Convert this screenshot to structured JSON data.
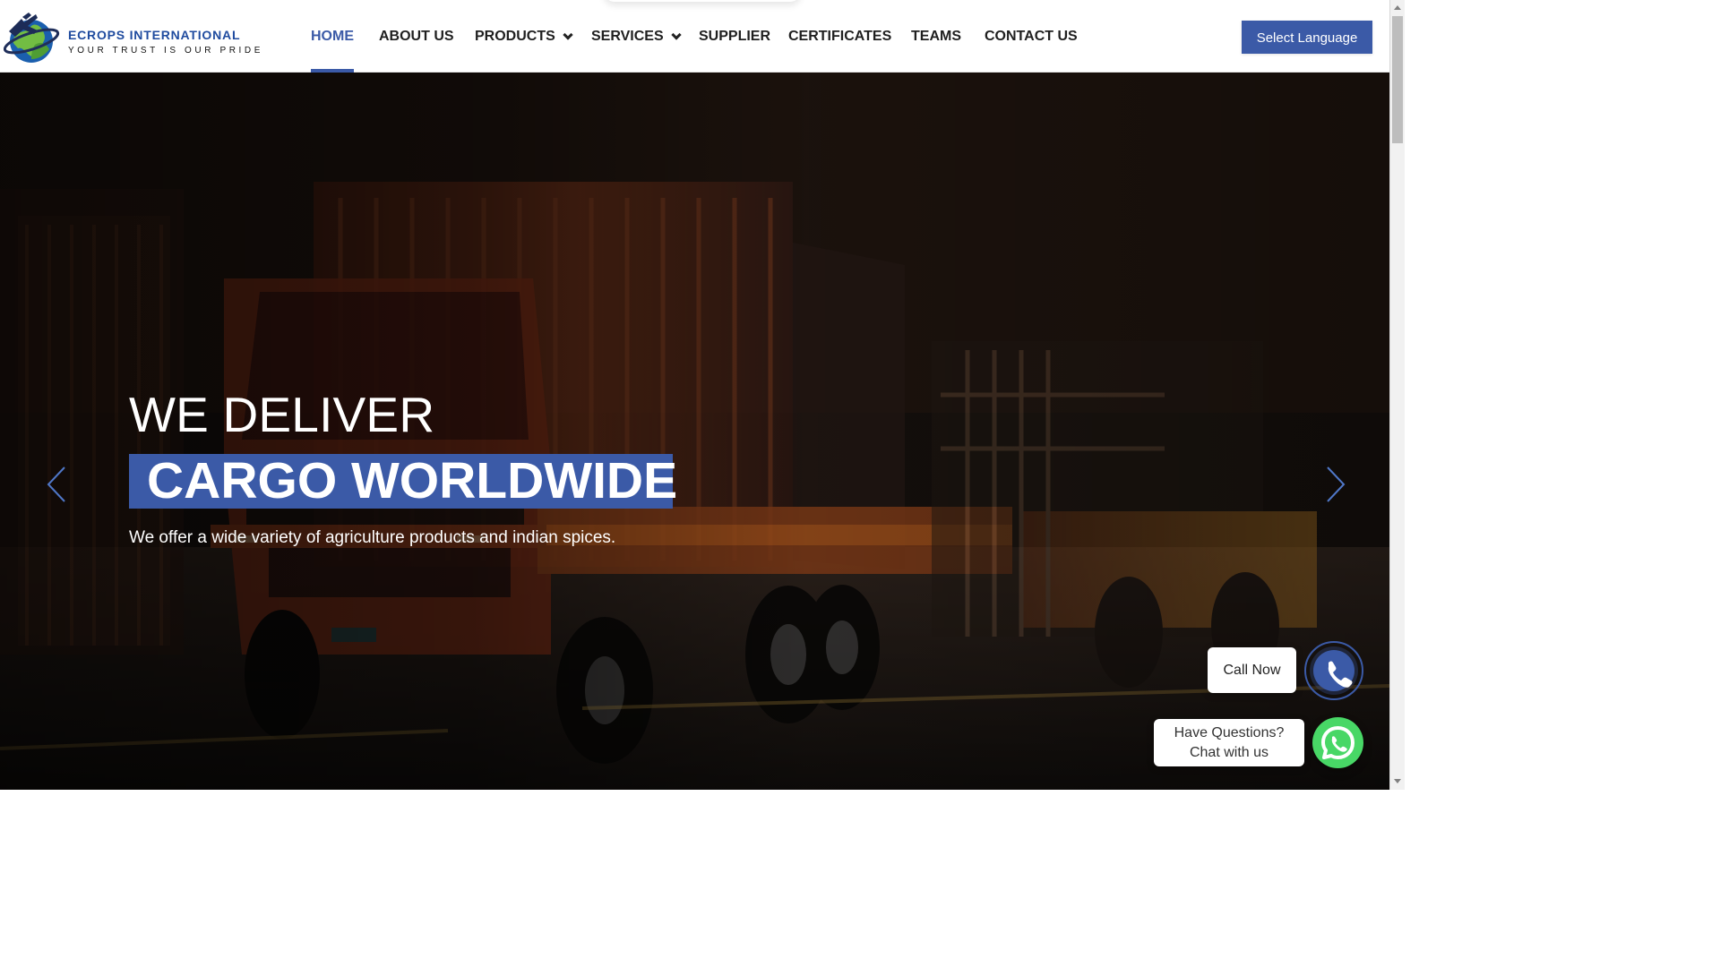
{
  "brand": {
    "name": "ECROPS INTERNATIONAL",
    "tagline": "YOUR TRUST IS OUR PRIDE",
    "logo_icon": "globe-airplane-icon"
  },
  "navigation": {
    "items": [
      {
        "label": "HOME",
        "active": true
      },
      {
        "label": "ABOUT US",
        "active": false
      },
      {
        "label": "PRODUCTS",
        "active": false,
        "icon": "chevron-down-icon"
      },
      {
        "label": "SERVICES",
        "active": false,
        "icon": "chevron-down-icon"
      },
      {
        "label": "SUPPLIER",
        "active": false
      },
      {
        "label": "CERTIFICATES",
        "active": false
      },
      {
        "label": "TEAMS",
        "active": false
      },
      {
        "label": "CONTACT US",
        "active": false
      }
    ],
    "language_button": "Select Language"
  },
  "hero": {
    "heading": "WE DELIVER",
    "highlight": "CARGO WORLDWIDE",
    "subtitle": "We offer a wide variety of agriculture products and indian spices.",
    "background_icon": "cargo-truck-image"
  },
  "floating_actions": {
    "call_label": "Call Now",
    "chat_line_1": "Have Questions?",
    "chat_line_2": "Chat with us",
    "call_icon": "phone-icon",
    "chat_icon": "whatsapp-icon"
  },
  "colors": {
    "brand_blue": "#3b5aa7",
    "whatsapp_green": "#48d766",
    "nav_text": "#1f1f1f",
    "header_background": "#ffffff"
  },
  "icons": {
    "previous": "chevron-left-icon",
    "next": "chevron-right-icon",
    "scroll_up": "scroll-up-icon",
    "scroll_down": "scroll-down-icon"
  }
}
